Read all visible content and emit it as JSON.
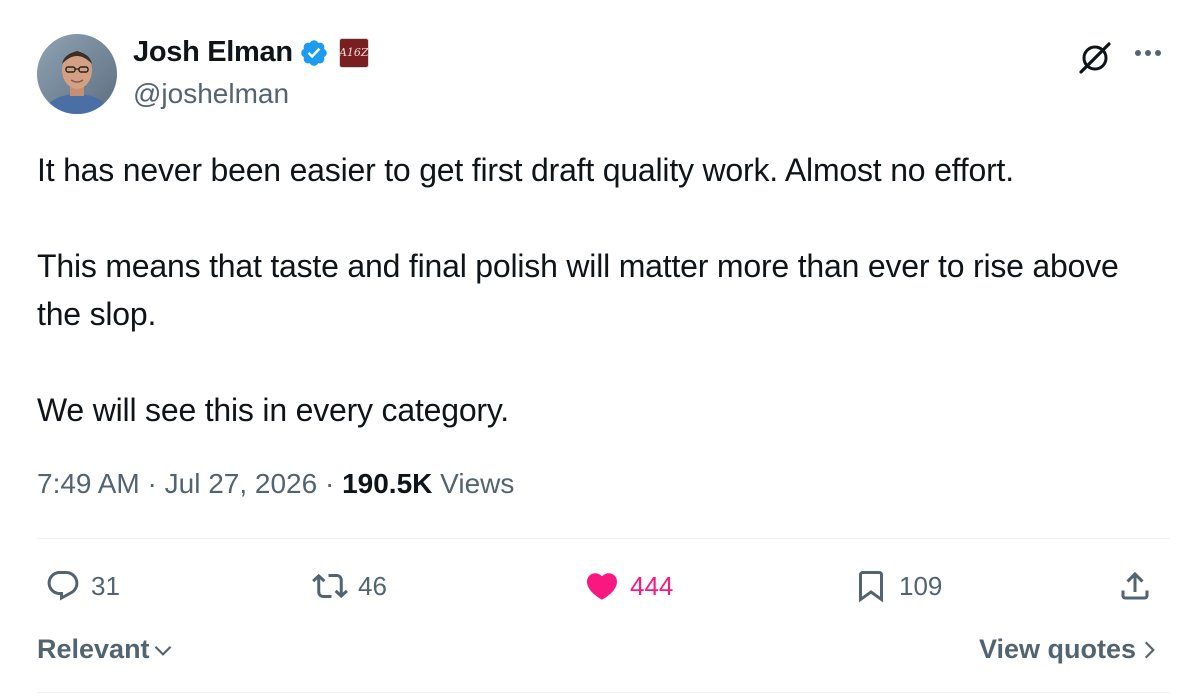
{
  "author": {
    "name": "Josh Elman",
    "handle": "@joshelman",
    "verified_color": "#1d9bf0",
    "affiliate_badge": "A16Z"
  },
  "tweet": {
    "paragraphs": [
      "It has never been easier to get first draft quality work. Almost no effort.",
      "This means that taste and final polish will matter more than ever to rise above the slop.",
      "We will see this in every category."
    ],
    "time": "7:49 AM",
    "sep1": "·",
    "date": "Jul 27, 2026",
    "sep2": "·",
    "views_count": "190.5K",
    "views_label": "Views"
  },
  "actions": {
    "replies": "31",
    "reposts": "46",
    "likes": "444",
    "bookmarks": "109",
    "like_color": "#f91880"
  },
  "footer": {
    "sort_label": "Relevant",
    "view_quotes_label": "View quotes"
  }
}
